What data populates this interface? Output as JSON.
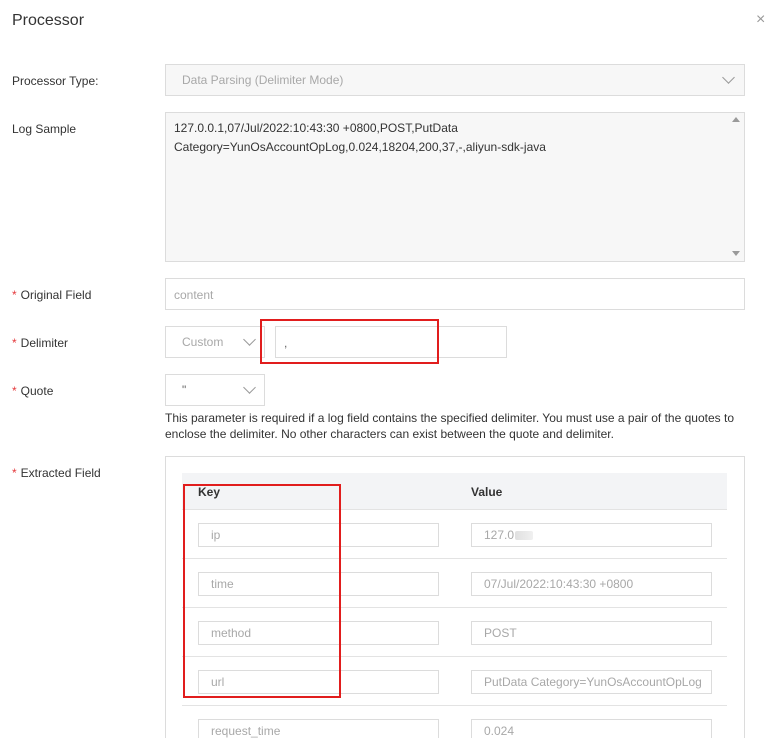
{
  "dialog": {
    "title": "Processor",
    "close_glyph": "×"
  },
  "processor_type": {
    "label": "Processor Type:",
    "value": "Data Parsing (Delimiter Mode)"
  },
  "log_sample": {
    "label": "Log Sample",
    "line1": "127.0.0.1,07/Jul/2022:10:43:30 +0800,POST,PutData",
    "line2": "Category=YunOsAccountOpLog,0.024,18204,200,37,-,aliyun-sdk-java"
  },
  "original_field": {
    "required": "*",
    "label": "Original Field",
    "placeholder": "content"
  },
  "delimiter": {
    "required": "*",
    "label": "Delimiter",
    "mode": "Custom",
    "value": ","
  },
  "quote": {
    "required": "*",
    "label": "Quote",
    "value": "\""
  },
  "quote_hint": "This parameter is required if a log field contains the specified delimiter. You must use a pair of the quotes to enclose the delimiter. No other characters can exist between the quote and delimiter.",
  "extracted_field": {
    "required": "*",
    "label": "Extracted Field",
    "columns": {
      "key": "Key",
      "value": "Value"
    },
    "rows": [
      {
        "key": "ip",
        "value": "127.0"
      },
      {
        "key": "time",
        "value": "07/Jul/2022:10:43:30 +0800"
      },
      {
        "key": "method",
        "value": "POST"
      },
      {
        "key": "url",
        "value": "PutData Category=YunOsAccountOpLog"
      },
      {
        "key": "request_time",
        "value": "0.024"
      }
    ]
  },
  "colors": {
    "highlight": "#e11d1d",
    "required": "#e4393c"
  }
}
